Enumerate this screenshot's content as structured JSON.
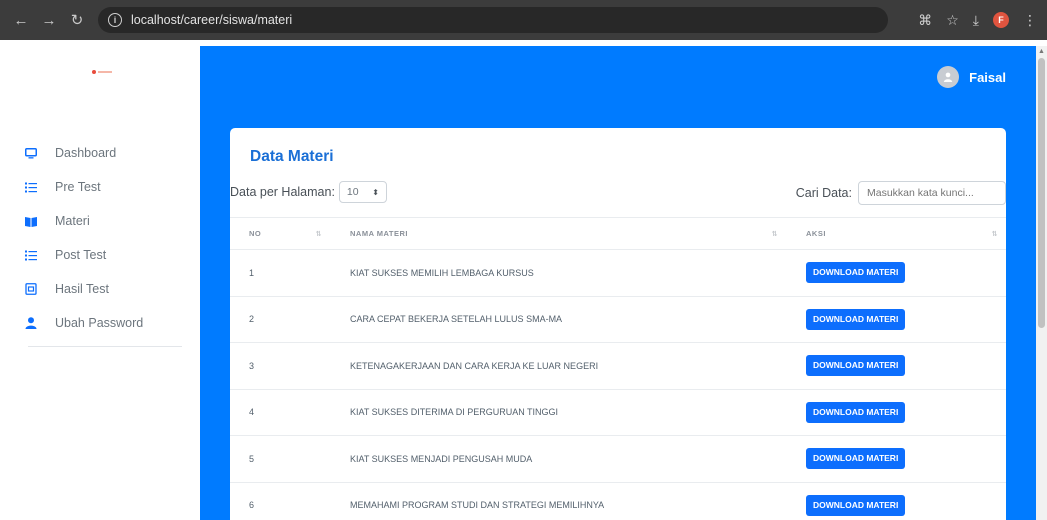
{
  "browser": {
    "url": "localhost/career/siswa/materi"
  },
  "sidebar": {
    "items": [
      {
        "label": "Dashboard",
        "icon": "monitor-icon"
      },
      {
        "label": "Pre Test",
        "icon": "list-icon"
      },
      {
        "label": "Materi",
        "icon": "book-icon"
      },
      {
        "label": "Post Test",
        "icon": "list-icon"
      },
      {
        "label": "Hasil Test",
        "icon": "result-icon"
      },
      {
        "label": "Ubah Password",
        "icon": "user-icon"
      }
    ]
  },
  "header": {
    "user_name": "Faisal"
  },
  "card": {
    "title": "Data Materi",
    "per_page_label": "Data per Halaman:",
    "per_page_value": "10",
    "search_label": "Cari Data:",
    "search_placeholder": "Masukkan kata kunci..."
  },
  "table": {
    "headers": [
      "NO",
      "NAMA MATERI",
      "AKSI"
    ],
    "button_label": "DOWNLOAD MATERI",
    "rows": [
      {
        "no": "1",
        "nama": "KIAT SUKSES MEMILIH LEMBAGA KURSUS"
      },
      {
        "no": "2",
        "nama": "CARA CEPAT BEKERJA SETELAH LULUS SMA-MA"
      },
      {
        "no": "3",
        "nama": "KETENAGAKERJAAN DAN CARA KERJA KE LUAR NEGERI"
      },
      {
        "no": "4",
        "nama": "KIAT SUKSES DITERIMA DI PERGURUAN TINGGI"
      },
      {
        "no": "5",
        "nama": "KIAT SUKSES MENJADI PENGUSAH MUDA"
      },
      {
        "no": "6",
        "nama": "MEMAHAMI PROGRAM STUDI DAN STRATEGI MEMILIHNYA"
      }
    ]
  },
  "colors": {
    "primary": "#007bff",
    "title": "#1a6fd6",
    "button": "#0d6efd"
  }
}
